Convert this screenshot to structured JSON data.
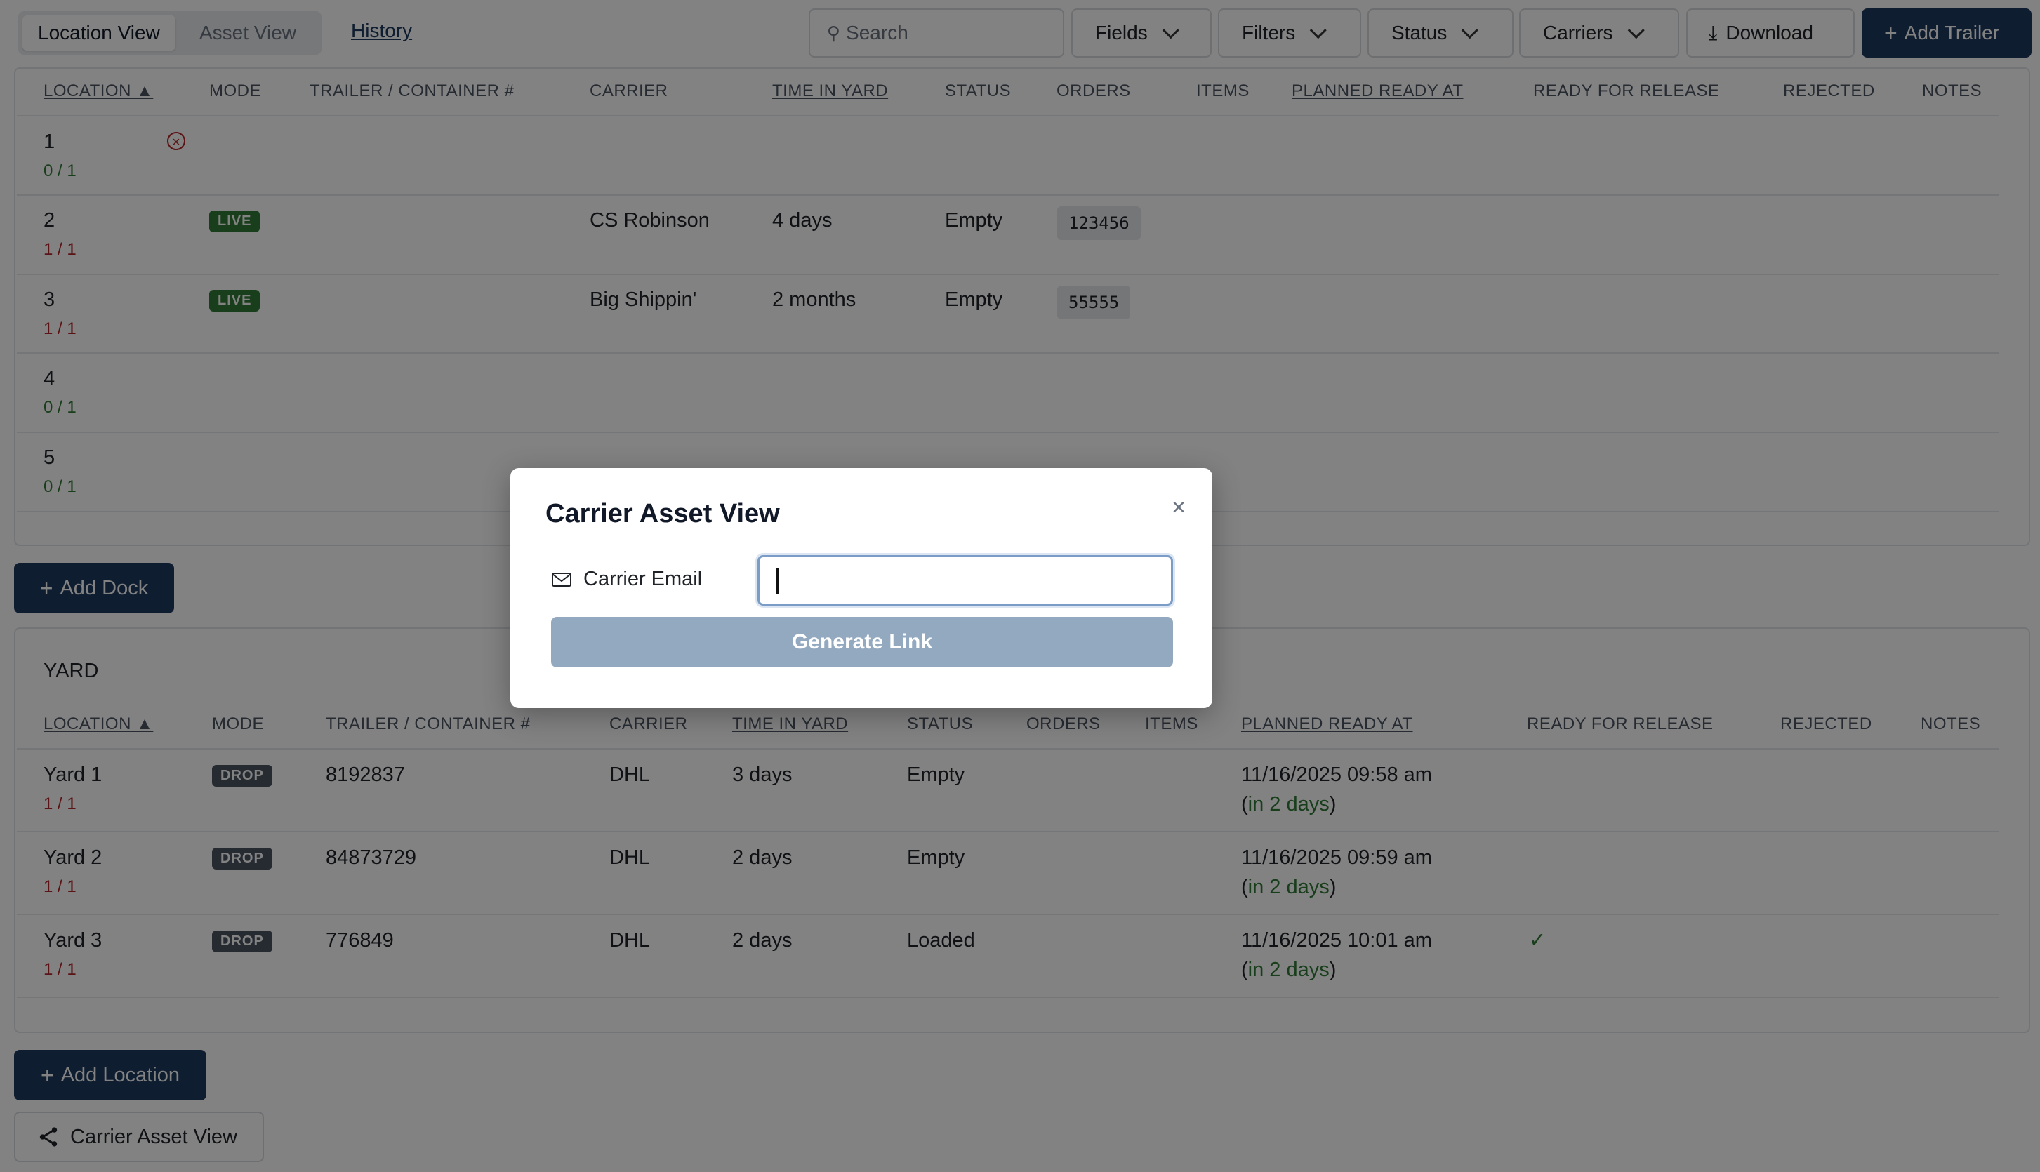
{
  "topbar": {
    "view_tabs": [
      {
        "label": "Location View"
      },
      {
        "label": "Asset View"
      }
    ],
    "history_label": "History",
    "search_placeholder": "Search",
    "fields_label": "Fields",
    "filters_label": "Filters",
    "status_label": "Status",
    "carriers_label": "Carriers",
    "download_label": "Download",
    "add_trailer_label": "Add Trailer"
  },
  "docks": {
    "headers": [
      "LOCATION",
      "MODE",
      "TRAILER / CONTAINER #",
      "CARRIER",
      "TIME IN YARD",
      "STATUS",
      "ORDERS",
      "ITEMS",
      "PLANNED READY AT",
      "READY FOR RELEASE",
      "REJECTED",
      "NOTES"
    ],
    "rows": [
      {
        "location": "1",
        "fraction": "0 / 1",
        "mode": "",
        "carrier": "",
        "time": "",
        "status": "",
        "order": ""
      },
      {
        "location": "2",
        "fraction": "1 / 1",
        "mode": "LIVE",
        "carrier": "CS Robinson",
        "time": "4 days",
        "status": "Empty",
        "order": "123456"
      },
      {
        "location": "3",
        "fraction": "1 / 1",
        "mode": "LIVE",
        "carrier": "Big Shippin'",
        "time": "2 months",
        "status": "Empty",
        "order": "55555"
      },
      {
        "location": "4",
        "fraction": "0 / 1",
        "mode": "",
        "carrier": "",
        "time": "",
        "status": "",
        "order": ""
      },
      {
        "location": "5",
        "fraction": "0 / 1",
        "mode": "",
        "carrier": "",
        "time": "",
        "status": "",
        "order": ""
      }
    ]
  },
  "add_dock_label": "Add Dock",
  "yard": {
    "title": "YARD",
    "headers": [
      "LOCATION",
      "MODE",
      "TRAILER / CONTAINER #",
      "CARRIER",
      "TIME IN YARD",
      "STATUS",
      "ORDERS",
      "ITEMS",
      "PLANNED READY AT",
      "READY FOR RELEASE",
      "REJECTED",
      "NOTES"
    ],
    "rows": [
      {
        "location": "Yard 1",
        "fraction": "1 / 1",
        "mode": "DROP",
        "trailer": "8192837",
        "carrier": "DHL",
        "time": "3 days",
        "status": "Empty",
        "planned": "11/16/2025 09:58 am",
        "relative": "in 2 days",
        "ready": ""
      },
      {
        "location": "Yard 2",
        "fraction": "1 / 1",
        "mode": "DROP",
        "trailer": "84873729",
        "carrier": "DHL",
        "time": "2 days",
        "status": "Empty",
        "planned": "11/16/2025 09:59 am",
        "relative": "in 2 days",
        "ready": ""
      },
      {
        "location": "Yard 3",
        "fraction": "1 / 1",
        "mode": "DROP",
        "trailer": "776849",
        "carrier": "DHL",
        "time": "2 days",
        "status": "Loaded",
        "planned": "11/16/2025 10:01 am",
        "relative": "in 2 days",
        "ready": "✓"
      }
    ]
  },
  "add_location_label": "Add Location",
  "carrier_asset_view_label": "Carrier Asset View",
  "modal": {
    "title": "Carrier Asset View",
    "email_label": "Carrier Email",
    "email_value": "",
    "generate_label": "Generate Link"
  },
  "colors": {
    "primary": "#1e3a5f",
    "live": "#2f7a35",
    "drop": "#4b5563",
    "disabled": "#93a9c0"
  }
}
